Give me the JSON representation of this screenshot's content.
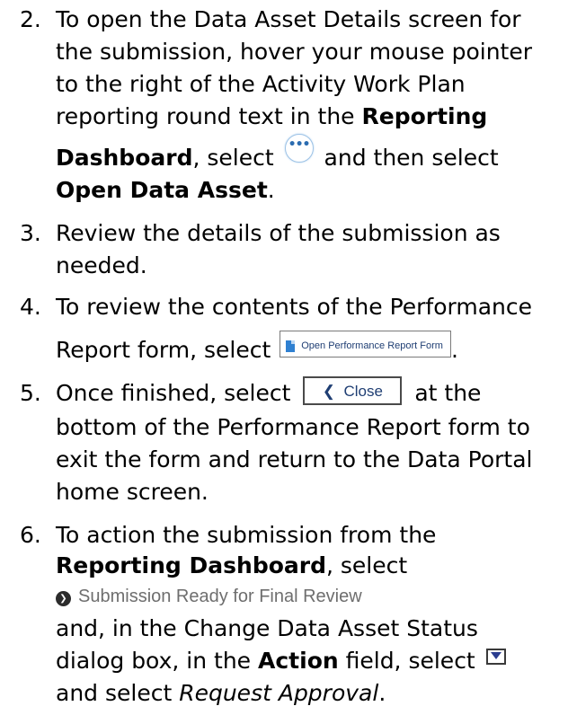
{
  "steps": [
    {
      "number": "2.",
      "lines": [
        "To open the Data Asset Details screen for",
        "the submission, hover your mouse pointer",
        "to the right of the Activity Work Plan",
        "reporting round text in the ",
        "Reporting",
        "Dashboard",
        ", select ",
        " and then select",
        "Open Data Asset",
        "."
      ]
    },
    {
      "number": "3.",
      "lines": [
        "Review the details of the submission as",
        "needed."
      ]
    },
    {
      "number": "4.",
      "lines": [
        "To review the contents of the Performance",
        "Report form, select ",
        "."
      ]
    },
    {
      "number": "5.",
      "lines": [
        "Once finished, select ",
        " at the",
        "bottom of the Performance Report form to",
        "exit the form and return to the Data Portal",
        "home screen."
      ]
    },
    {
      "number": "6.",
      "lines": [
        "To action the submission from the",
        "Reporting Dashboard",
        ", select",
        "and, in the Change Data Asset Status",
        "dialog box, in the ",
        "Action",
        " field, select ",
        "and select ",
        "Request Approval",
        "."
      ]
    }
  ],
  "ui": {
    "ellipsis_glyph": "•••",
    "open_form_label": "Open Performance Report Form",
    "close_label": "Close",
    "close_glyph": "❮",
    "status_link_label": "Submission Ready for Final Review",
    "status_link_glyph": "❯"
  },
  "icons": [
    "ellipsis-icon",
    "document-icon",
    "chevron-left-icon",
    "chevron-right-circle-icon",
    "dropdown-arrow-icon"
  ]
}
